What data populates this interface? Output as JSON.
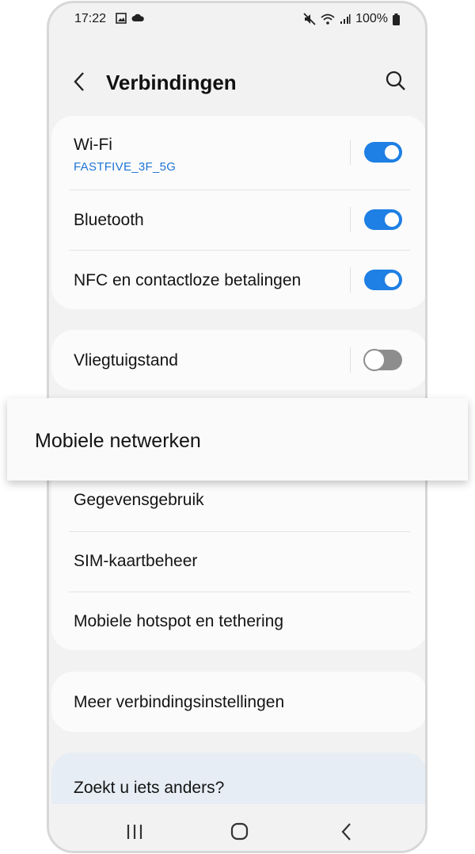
{
  "status_bar": {
    "time": "17:22",
    "battery": "100%",
    "icons": [
      "image-icon",
      "cloud-icon",
      "mute-icon",
      "wifi-icon",
      "signal-icon",
      "battery-icon"
    ]
  },
  "header": {
    "title": "Verbindingen",
    "icons": [
      "back-arrow-icon",
      "search-icon"
    ]
  },
  "connections": [
    {
      "label": "Wi-Fi",
      "sub": "FASTFIVE_3F_5G",
      "toggle": "on"
    },
    {
      "label": "Bluetooth",
      "toggle": "on"
    },
    {
      "label": "NFC en contactloze betalingen",
      "toggle": "on"
    }
  ],
  "airplane": {
    "label": "Vliegtuigstand",
    "toggle": "off"
  },
  "highlighted": {
    "label": "Mobiele netwerken"
  },
  "network_items": [
    {
      "label": "Gegevensgebruik"
    },
    {
      "label": "SIM-kaartbeheer"
    },
    {
      "label": "Mobiele hotspot en tethering"
    }
  ],
  "more": {
    "label": "Meer verbindingsinstellingen"
  },
  "suggest": {
    "label": "Zoekt u iets anders?"
  },
  "nav": {
    "icons": [
      "recent-apps-icon",
      "home-icon",
      "back-icon"
    ]
  },
  "colors": {
    "accent": "#1e7fe4",
    "subtext": "#1e74d4",
    "toggle_off": "#8d8d8d"
  }
}
